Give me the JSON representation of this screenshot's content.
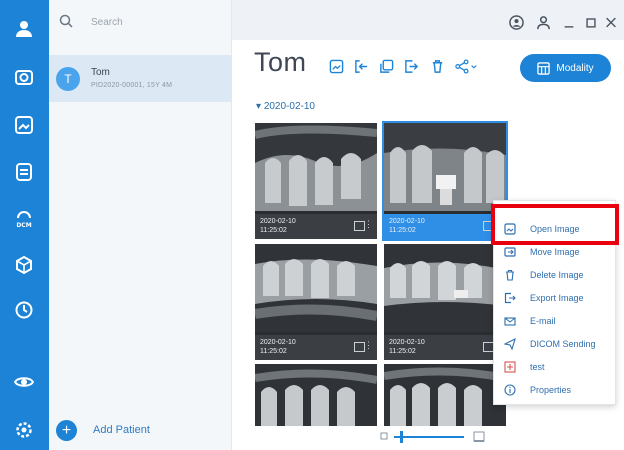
{
  "search": {
    "placeholder": "Search"
  },
  "patient": {
    "initial": "T",
    "name": "Tom",
    "details": "PID2020-00001, 15Y 4M"
  },
  "add_patient": {
    "label": "Add Patient"
  },
  "main": {
    "title": "Tom",
    "modality_label": "Modality",
    "date_group": "2020-02-10"
  },
  "thumbnails": [
    {
      "date": "2020-02-10",
      "time": "11:25:02"
    },
    {
      "date": "2020-02-10",
      "time": "11:25:02"
    },
    {
      "date": "2020-02-10",
      "time": "11:25:02"
    },
    {
      "date": "2020-02-10",
      "time": "11:25:02"
    }
  ],
  "context_menu": {
    "items": [
      {
        "label": "Open Image",
        "icon": "open-image-icon"
      },
      {
        "label": "Move Image",
        "icon": "move-image-icon"
      },
      {
        "label": "Delete Image",
        "icon": "trash-icon"
      },
      {
        "label": "Export Image",
        "icon": "export-icon"
      },
      {
        "label": "E-mail",
        "icon": "email-icon"
      },
      {
        "label": "DICOM Sending",
        "icon": "send-icon"
      },
      {
        "label": "test",
        "icon": "plus-box-icon"
      },
      {
        "label": "Properties",
        "icon": "info-icon"
      }
    ]
  },
  "colors": {
    "accent": "#1d83d6",
    "highlight": "#e8000e",
    "selected": "#2f8ee6"
  }
}
